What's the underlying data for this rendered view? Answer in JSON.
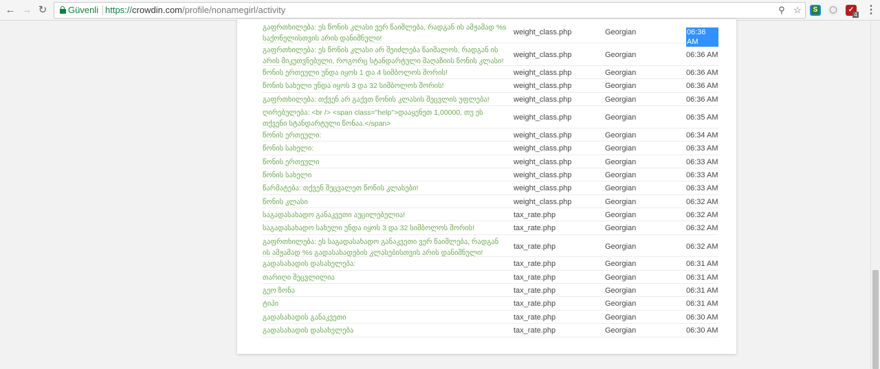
{
  "browser": {
    "secure_label": "Güvenli",
    "url_scheme": "https://",
    "url_host": "crowdin.com",
    "url_path": "/profile/nonamegirl/activity",
    "extension_badge": "4"
  },
  "activity": {
    "rows": [
      {
        "text": "გაფრთხილება: ეს წონის კლასი ვერ წაიშლება, რადგან ის ამჟამად %s საქონელისთვის არის დანიშნული!",
        "file": "weight_class.php",
        "language": "Georgian",
        "time": "06:36 AM",
        "selected": true
      },
      {
        "text": "გაფრთხილება: ეს წონის კლასი არ შეიძლება წაიშალოს, რადგან ის არის მიკუთვნებული, როგორც სტანდარტული მაღაზიის წონის კლასი!",
        "file": "weight_class.php",
        "language": "Georgian",
        "time": "06:36 AM"
      },
      {
        "text": "წონის ერთეული უნდა იყოს 1 და 4 სიმბოლოს შორის!",
        "file": "weight_class.php",
        "language": "Georgian",
        "time": "06:36 AM"
      },
      {
        "text": "წონის სახელი უნდა იყოს 3 და 32 სიმბოლოს შორის!",
        "file": "weight_class.php",
        "language": "Georgian",
        "time": "06:36 AM"
      },
      {
        "text": "გაფრთხილება: თქვენ არ გაქვთ წონის კლასის შეცვლის უფლება!",
        "file": "weight_class.php",
        "language": "Georgian",
        "time": "06:36 AM"
      },
      {
        "text": "ღირებულება: <br /> <span class=\"help\">დააყენეთ 1,00000, თუ ეს თქვენი სტანდარტული წონაა.</span>",
        "file": "weight_class.php",
        "language": "Georgian",
        "time": "06:35 AM"
      },
      {
        "text": "წონის ერთეული:",
        "file": "weight_class.php",
        "language": "Georgian",
        "time": "06:34 AM"
      },
      {
        "text": "წონის სახელი:",
        "file": "weight_class.php",
        "language": "Georgian",
        "time": "06:33 AM"
      },
      {
        "text": "წონის ერთეული",
        "file": "weight_class.php",
        "language": "Georgian",
        "time": "06:33 AM"
      },
      {
        "text": "წონის სახელი",
        "file": "weight_class.php",
        "language": "Georgian",
        "time": "06:33 AM"
      },
      {
        "text": "წარმატება: თქვენ შეცვალეთ წონის კლასები!",
        "file": "weight_class.php",
        "language": "Georgian",
        "time": "06:33 AM"
      },
      {
        "text": "წონის კლასი",
        "file": "weight_class.php",
        "language": "Georgian",
        "time": "06:32 AM"
      },
      {
        "text": "საგადასახადო განაკვეთი აუცილებელია!",
        "file": "tax_rate.php",
        "language": "Georgian",
        "time": "06:32 AM"
      },
      {
        "text": "საგადასახადო სახელი უნდა იყოს 3 და 32 სიმბოლოს შორის!",
        "file": "tax_rate.php",
        "language": "Georgian",
        "time": "06:32 AM"
      },
      {
        "text": "გაფრთხილება: ეს საგადასახადო განაკვეთი ვერ წაიშლება, რადგან ის ამჟამად %s გადასახადების კლასებისთვის არის დანიშნული!",
        "file": "tax_rate.php",
        "language": "Georgian",
        "time": "06:32 AM"
      },
      {
        "text": "გადასახადის დასახელება:",
        "file": "tax_rate.php",
        "language": "Georgian",
        "time": "06:31 AM"
      },
      {
        "text": "თარიღი შეცვლილია",
        "file": "tax_rate.php",
        "language": "Georgian",
        "time": "06:31 AM"
      },
      {
        "text": "გეო ზონა",
        "file": "tax_rate.php",
        "language": "Georgian",
        "time": "06:31 AM"
      },
      {
        "text": "ტიპი",
        "file": "tax_rate.php",
        "language": "Georgian",
        "time": "06:31 AM"
      },
      {
        "text": "გადასახადის განაკვეთი",
        "file": "tax_rate.php",
        "language": "Georgian",
        "time": "06:30 AM"
      },
      {
        "text": "გადასახადის დასახელება",
        "file": "tax_rate.php",
        "language": "Georgian",
        "time": "06:30 AM"
      }
    ]
  }
}
